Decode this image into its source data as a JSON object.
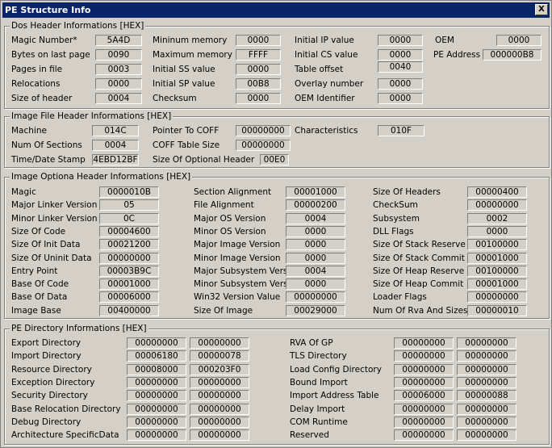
{
  "window": {
    "title": "PE Structure Info",
    "close_label": "X"
  },
  "dos": {
    "legend": "Dos Header Informations [HEX]",
    "rows": [
      [
        [
          "Magic Number*",
          "5A4D"
        ],
        [
          "Mininum memory",
          "0000"
        ],
        [
          "Initial IP value",
          "0000"
        ],
        [
          "OEM",
          "0000"
        ]
      ],
      [
        [
          "Bytes on last page",
          "0090"
        ],
        [
          "Maximum memory",
          "FFFF"
        ],
        [
          "Initial CS value",
          "0000"
        ],
        [
          "PE Address",
          "000000B8"
        ]
      ],
      [
        [
          "Pages in file",
          "0003"
        ],
        [
          "Initial SS value",
          "0000"
        ],
        [
          "Table offset",
          "0040"
        ]
      ],
      [
        [
          "Relocations",
          "0000"
        ],
        [
          "Initial SP value",
          "00B8"
        ],
        [
          "Overlay number",
          "0000"
        ]
      ],
      [
        [
          "Size of header",
          "0004"
        ],
        [
          "Checksum",
          "0000"
        ],
        [
          "OEM Identifier",
          "0000"
        ]
      ]
    ]
  },
  "file": {
    "legend": "Image File Header Informations [HEX]",
    "rows": [
      [
        [
          "Machine",
          "014C"
        ],
        [
          "Pointer To COFF",
          "00000000"
        ],
        [
          "Characteristics",
          "010F"
        ]
      ],
      [
        [
          "Num Of Sections",
          "0004"
        ],
        [
          "COFF Table Size",
          "00000000"
        ]
      ],
      [
        [
          "Time/Date Stamp",
          "4EBD12BF"
        ],
        [
          "Size Of Optional Header",
          "00E0"
        ]
      ]
    ]
  },
  "opt": {
    "legend": "Image Optiona Header Informations [HEX]",
    "rows": [
      [
        [
          "Magic",
          "0000010B"
        ],
        [
          "Section Alignment",
          "00001000"
        ],
        [
          "Size Of Headers",
          "00000400"
        ]
      ],
      [
        [
          "Major Linker Version",
          "05"
        ],
        [
          "File Alignment",
          "00000200"
        ],
        [
          "CheckSum",
          "00000000"
        ]
      ],
      [
        [
          "Minor Linker Version",
          "0C"
        ],
        [
          "Major OS Version",
          "0004"
        ],
        [
          "Subsystem",
          "0002"
        ]
      ],
      [
        [
          "Size Of Code",
          "00004600"
        ],
        [
          "Minor OS Version",
          "0000"
        ],
        [
          "DLL Flags",
          "0000"
        ]
      ],
      [
        [
          "Size Of Init Data",
          "00021200"
        ],
        [
          "Major Image Version",
          "0000"
        ],
        [
          "Size Of Stack Reserve",
          "00100000"
        ]
      ],
      [
        [
          "Size Of Uninit Data",
          "00000000"
        ],
        [
          "Minor Image Version",
          "0000"
        ],
        [
          "Size Of Stack Commit",
          "00001000"
        ]
      ],
      [
        [
          "Entry Point",
          "00003B9C"
        ],
        [
          "Major Subsystem Version",
          "0004"
        ],
        [
          "Size Of Heap Reserve",
          "00100000"
        ]
      ],
      [
        [
          "Base Of Code",
          "00001000"
        ],
        [
          "Minor Subsystem Version",
          "0000"
        ],
        [
          "Size Of Heap Commit",
          "00001000"
        ]
      ],
      [
        [
          "Base Of Data",
          "00006000"
        ],
        [
          "Win32 Version Value",
          "00000000"
        ],
        [
          "Loader Flags",
          "00000000"
        ]
      ],
      [
        [
          "Image Base",
          "00400000"
        ],
        [
          "Size Of Image",
          "00029000"
        ],
        [
          "Num Of Rva And Sizes",
          "00000010"
        ]
      ]
    ]
  },
  "dir": {
    "legend": "PE Directory Informations [HEX]",
    "rows": [
      [
        [
          "Export Directory",
          "00000000",
          "00000000"
        ],
        [
          "RVA Of GP",
          "00000000",
          "00000000"
        ]
      ],
      [
        [
          "Import Directory",
          "00006180",
          "00000078"
        ],
        [
          "TLS Directory",
          "00000000",
          "00000000"
        ]
      ],
      [
        [
          "Resource Directory",
          "00008000",
          "000203F0"
        ],
        [
          "Load Config Directory",
          "00000000",
          "00000000"
        ]
      ],
      [
        [
          "Exception Directory",
          "00000000",
          "00000000"
        ],
        [
          "Bound Import",
          "00000000",
          "00000000"
        ]
      ],
      [
        [
          "Security Directory",
          "00000000",
          "00000000"
        ],
        [
          "Import Address Table",
          "00006000",
          "00000088"
        ]
      ],
      [
        [
          "Base Relocation Directory",
          "00000000",
          "00000000"
        ],
        [
          "Delay Import",
          "00000000",
          "00000000"
        ]
      ],
      [
        [
          "Debug Directory",
          "00000000",
          "00000000"
        ],
        [
          "COM Runtime",
          "00000000",
          "00000000"
        ]
      ],
      [
        [
          "Architecture SpecificData",
          "00000000",
          "00000000"
        ],
        [
          "Reserved",
          "00000000",
          "00000000"
        ]
      ]
    ]
  }
}
